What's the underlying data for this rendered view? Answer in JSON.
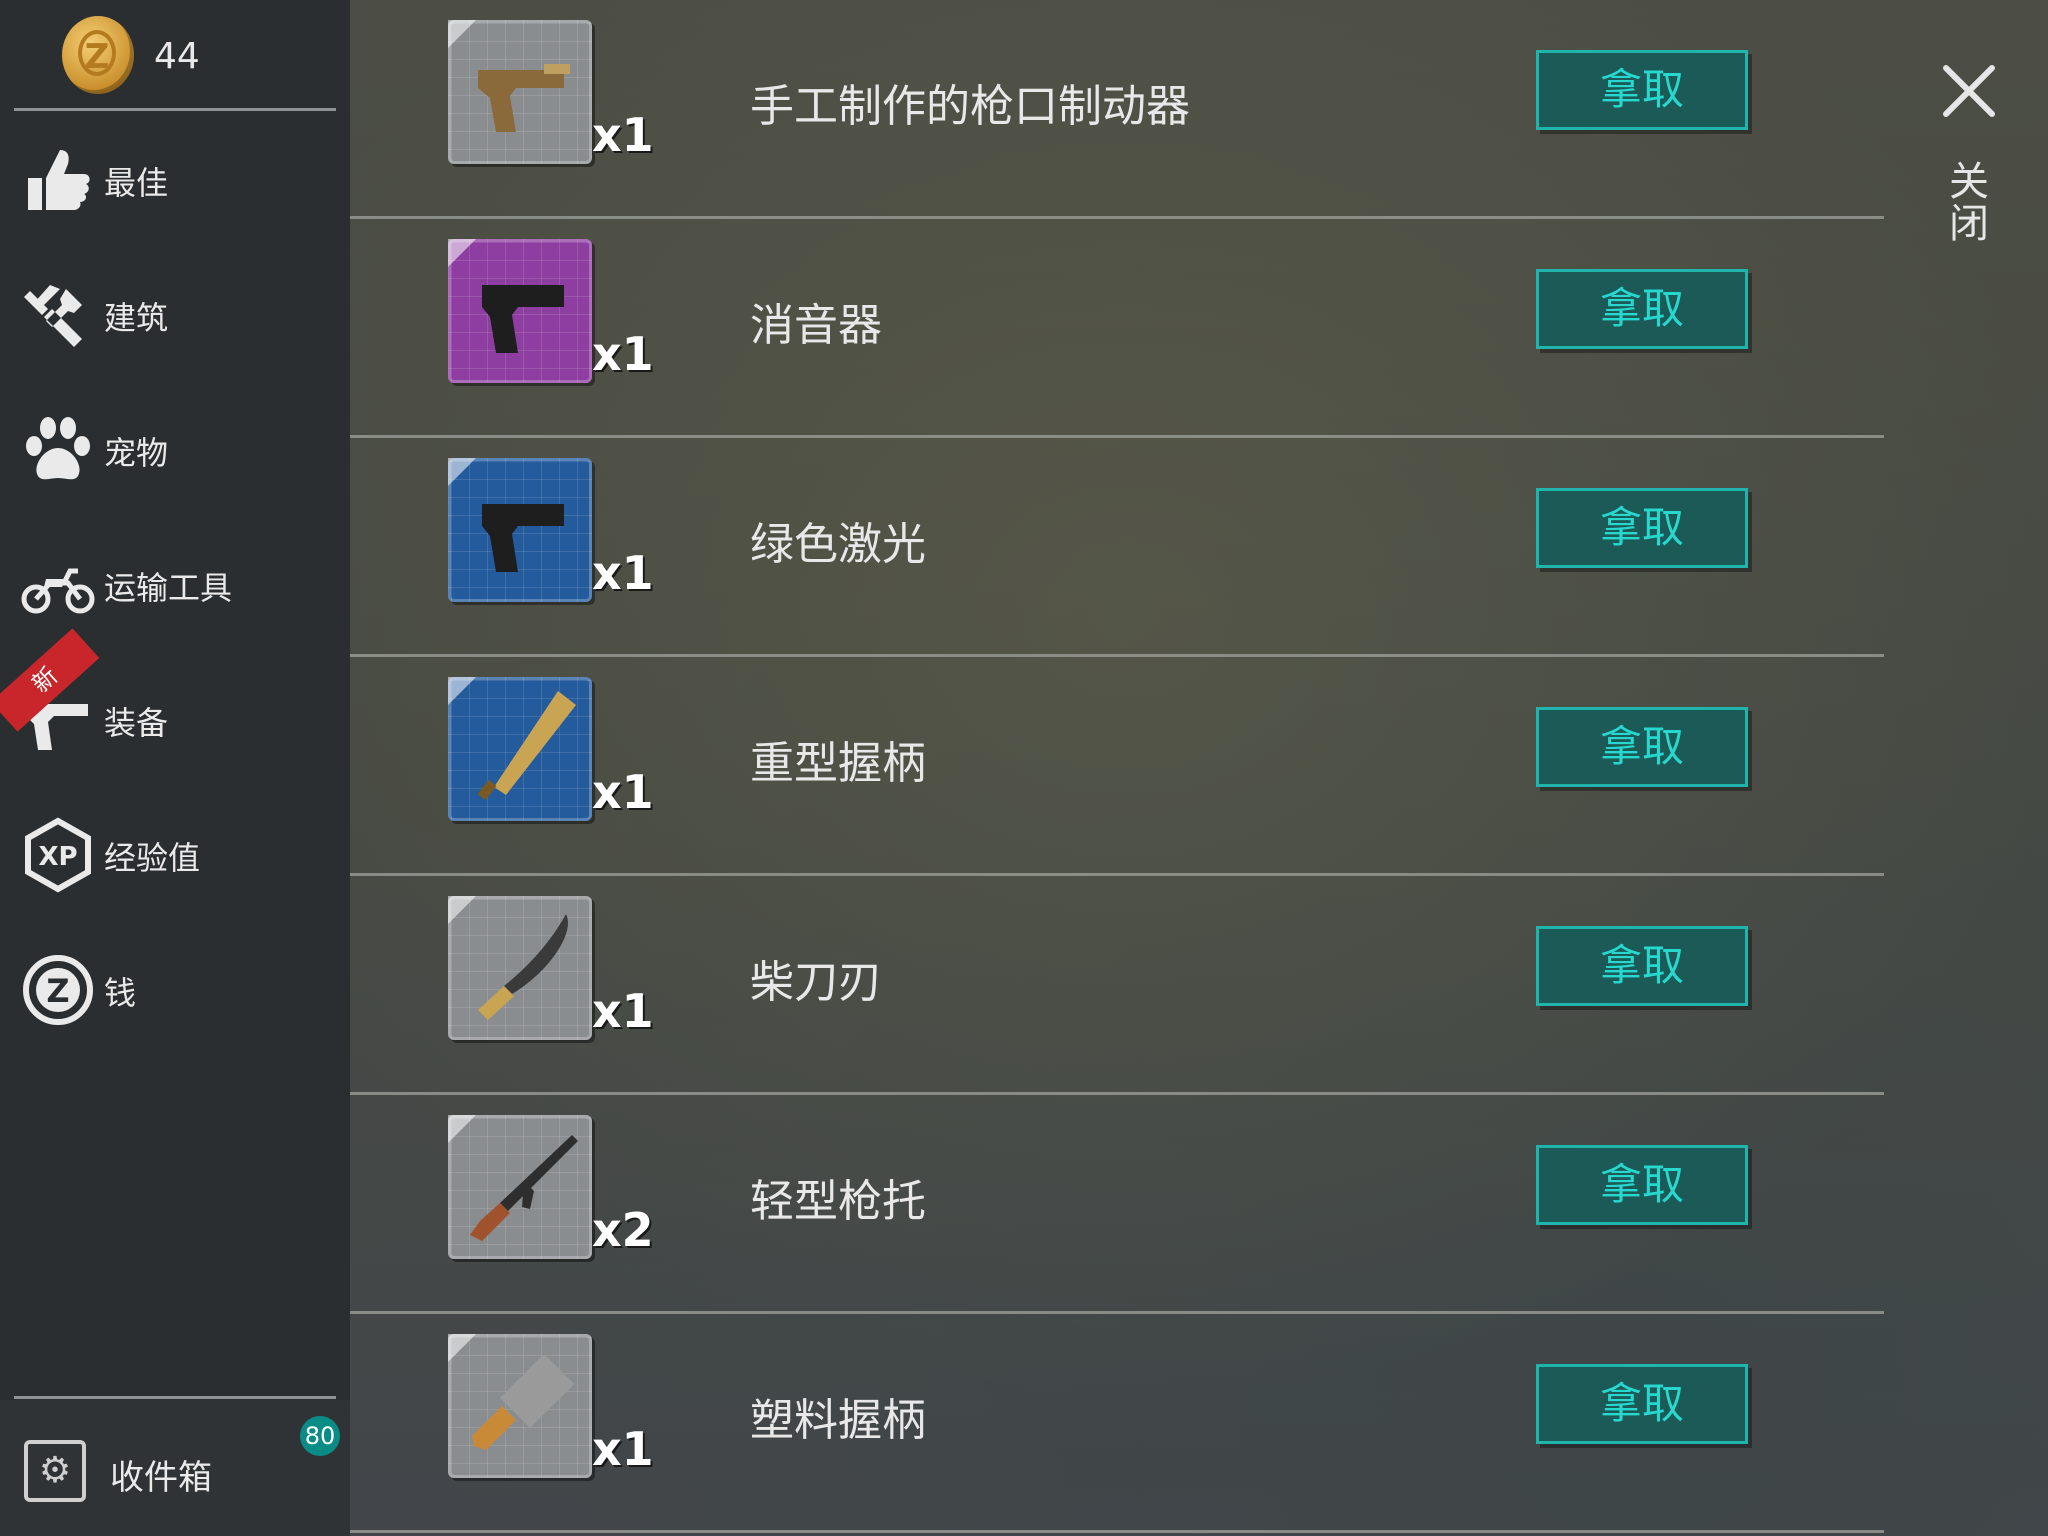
{
  "currency": {
    "value": "44",
    "symbol": "Z"
  },
  "sidebar": {
    "items": [
      {
        "label": "最佳",
        "icon": "thumbs-up-icon"
      },
      {
        "label": "建筑",
        "icon": "tools-icon"
      },
      {
        "label": "宠物",
        "icon": "paw-icon"
      },
      {
        "label": "运输工具",
        "icon": "motorcycle-icon"
      },
      {
        "label": "装备",
        "icon": "gun-icon",
        "badge": "新"
      },
      {
        "label": "经验值",
        "icon": "xp-icon",
        "icon_text": "XP"
      },
      {
        "label": "钱",
        "icon": "coin-icon",
        "icon_text": "Z"
      }
    ],
    "inbox": {
      "label": "收件箱",
      "count": "80",
      "icon": "safe-icon"
    }
  },
  "items": [
    {
      "name": "手工制作的枪口制动器",
      "qty": "x1",
      "rarity": "gray",
      "icon": "pistol-icon"
    },
    {
      "name": "消音器",
      "qty": "x1",
      "rarity": "purple",
      "icon": "pistol-icon"
    },
    {
      "name": "绿色激光",
      "qty": "x1",
      "rarity": "blue",
      "icon": "pistol-icon"
    },
    {
      "name": "重型握柄",
      "qty": "x1",
      "rarity": "blue",
      "icon": "bat-icon"
    },
    {
      "name": "柴刀刃",
      "qty": "x1",
      "rarity": "gray",
      "icon": "machete-icon"
    },
    {
      "name": "轻型枪托",
      "qty": "x2",
      "rarity": "gray",
      "icon": "rifle-icon"
    },
    {
      "name": "塑料握柄",
      "qty": "x1",
      "rarity": "gray",
      "icon": "cleaver-icon"
    }
  ],
  "take_label": "拿取",
  "close_label": "关闭",
  "colors": {
    "gray": "#8a8d90",
    "purple": "#8e3ea0",
    "blue": "#235b9c",
    "accent": "#1fb5ad"
  }
}
